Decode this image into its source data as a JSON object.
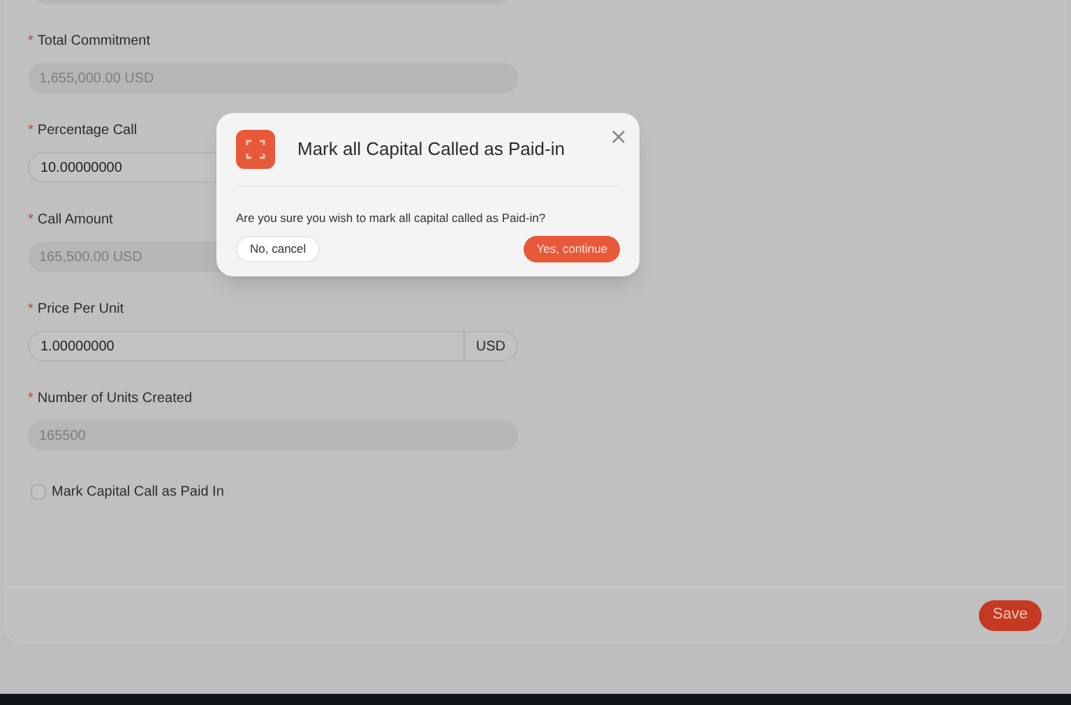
{
  "form": {
    "fields": [
      {
        "label": "Total Commitment",
        "required_mark": "*",
        "value": "1,655,000.00 USD",
        "disabled": true
      },
      {
        "label": "Percentage Call",
        "required_mark": "*",
        "value": "10.00000000",
        "disabled": false
      },
      {
        "label": "Call Amount",
        "required_mark": "*",
        "value": "165,500.00 USD",
        "disabled": true
      },
      {
        "label": "Price Per Unit",
        "required_mark": "*",
        "value": "1.00000000",
        "disabled": false,
        "suffix": "USD"
      },
      {
        "label": "Number of Units Created",
        "required_mark": "*",
        "value": "165500",
        "disabled": true
      }
    ],
    "checkbox": {
      "label": "Mark Capital Call as Paid In",
      "checked": false
    },
    "save_button": "Save"
  },
  "dialog": {
    "title": "Mark all Capital Called as Paid-in",
    "message": "Are you sure you wish to mark all capital called as Paid-in?",
    "cancel_button": "No, cancel",
    "confirm_button": "Yes, continue"
  }
}
